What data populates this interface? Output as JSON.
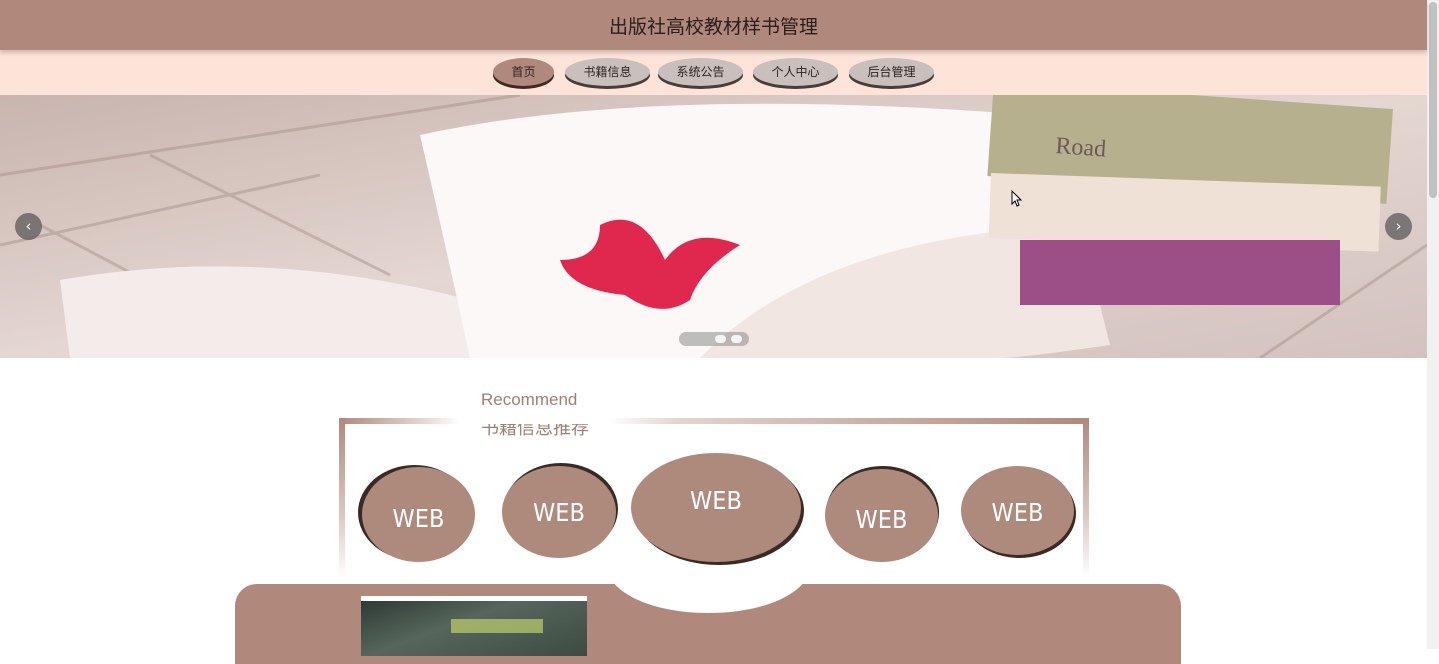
{
  "header": {
    "title": "出版社高校教材样书管理"
  },
  "nav": {
    "items": [
      {
        "label": "首页",
        "active": true
      },
      {
        "label": "书籍信息",
        "active": false
      },
      {
        "label": "系统公告",
        "active": false
      },
      {
        "label": "个人中心",
        "active": false
      },
      {
        "label": "后台管理",
        "active": false
      }
    ]
  },
  "banner": {
    "prev_icon": "chevron-left-icon",
    "next_icon": "chevron-right-icon",
    "prev_glyph": "‹",
    "next_glyph": "›",
    "slide_count": 3,
    "active_slide": 1,
    "book_title": "Road"
  },
  "recommend": {
    "title_en": "Recommend",
    "title_cn": "书籍信息推荐",
    "badges": [
      "WEB",
      "WEB",
      "WEB",
      "WEB",
      "WEB"
    ]
  },
  "colors": {
    "brand": "#b0887c",
    "nav_bg": "#fde3d8",
    "text_accent": "#9f7f74"
  }
}
